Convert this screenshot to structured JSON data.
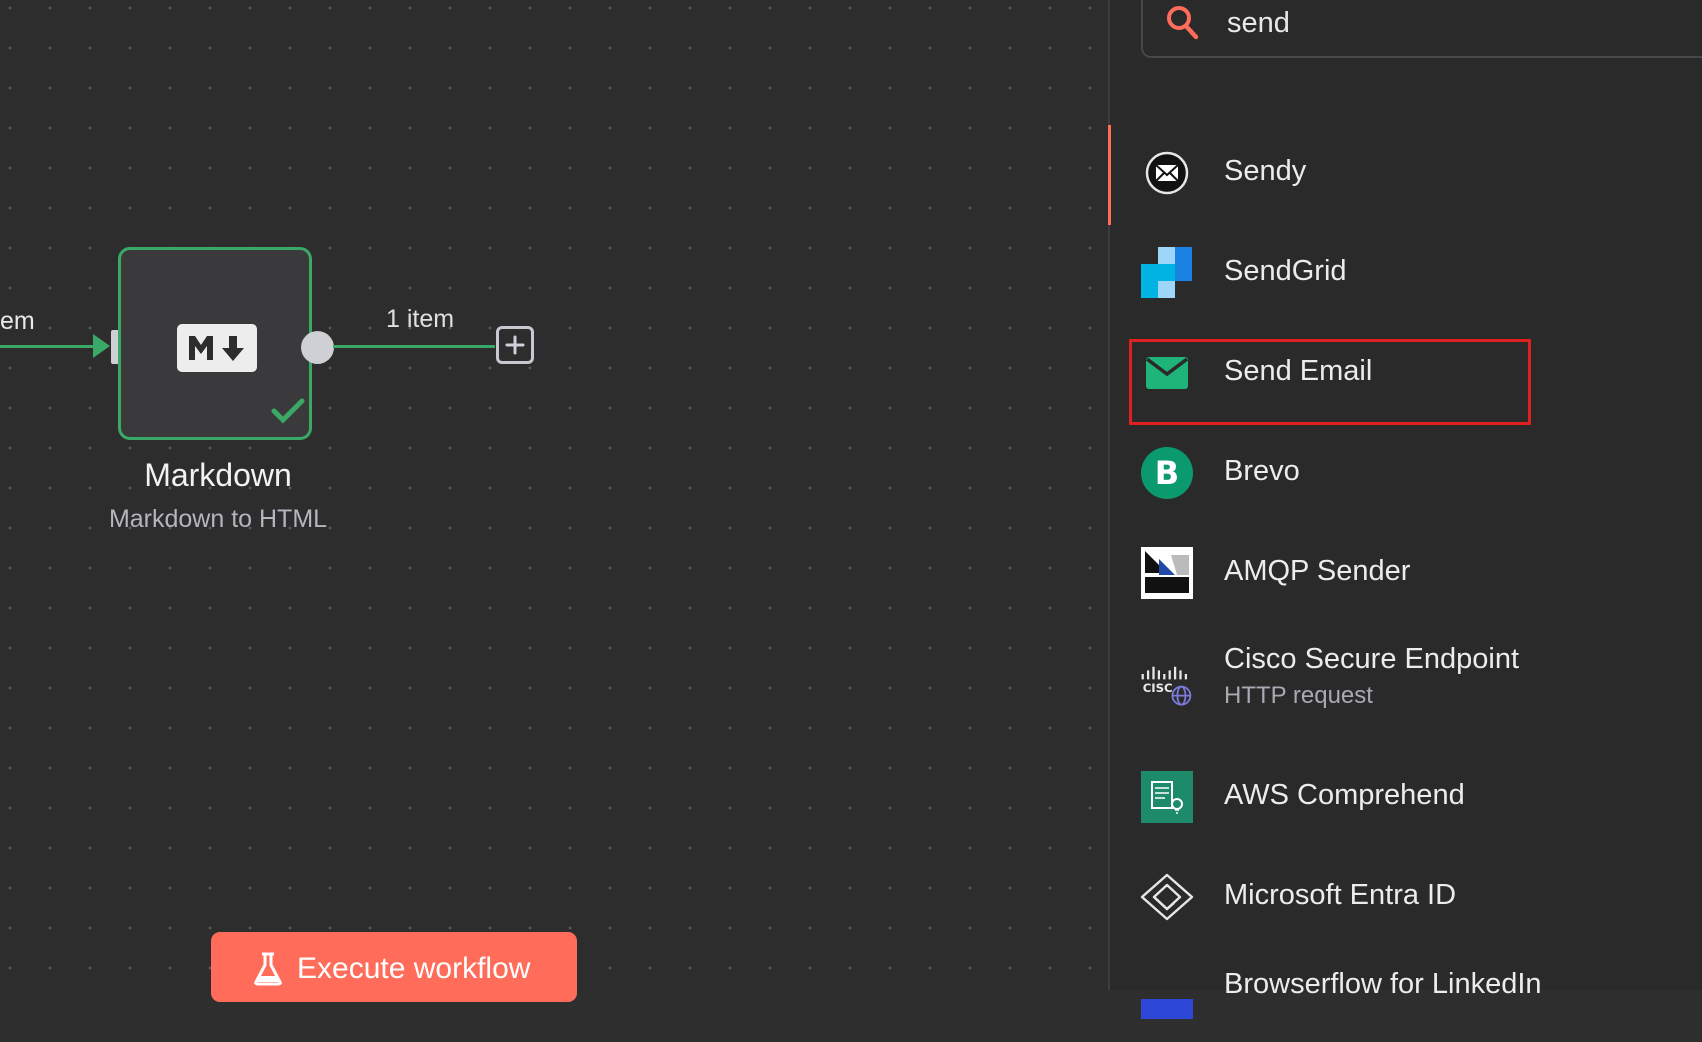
{
  "canvas": {
    "left_connection_label": "em",
    "item_count_label": "1 item",
    "node": {
      "badge_text": "M↓",
      "title": "Markdown",
      "subtitle": "Markdown to HTML",
      "status": "success"
    },
    "execute_button": {
      "label": "Execute workflow",
      "icon": "flask-icon"
    }
  },
  "panel": {
    "search": {
      "value": "send",
      "icon": "search-icon",
      "icon_color": "#ff6d5a"
    },
    "results": [
      {
        "label": "Sendy",
        "icon": "sendy-icon"
      },
      {
        "label": "SendGrid",
        "icon": "sendgrid-icon"
      },
      {
        "label": "Send Email",
        "icon": "envelope-icon",
        "highlighted": true
      },
      {
        "label": "Brevo",
        "icon": "brevo-icon"
      },
      {
        "label": "AMQP Sender",
        "icon": "amqp-icon"
      },
      {
        "label": "Cisco Secure Endpoint",
        "sublabel": "HTTP request",
        "icon": "cisco-icon"
      },
      {
        "label": "AWS Comprehend",
        "icon": "aws-comprehend-icon"
      },
      {
        "label": "Microsoft Entra ID",
        "icon": "entra-icon"
      },
      {
        "label": "Browserflow for LinkedIn",
        "icon": "browserflow-icon"
      }
    ]
  },
  "colors": {
    "accent": "#ff6d5a",
    "success": "#3aa866",
    "highlight_box": "#e02020"
  }
}
